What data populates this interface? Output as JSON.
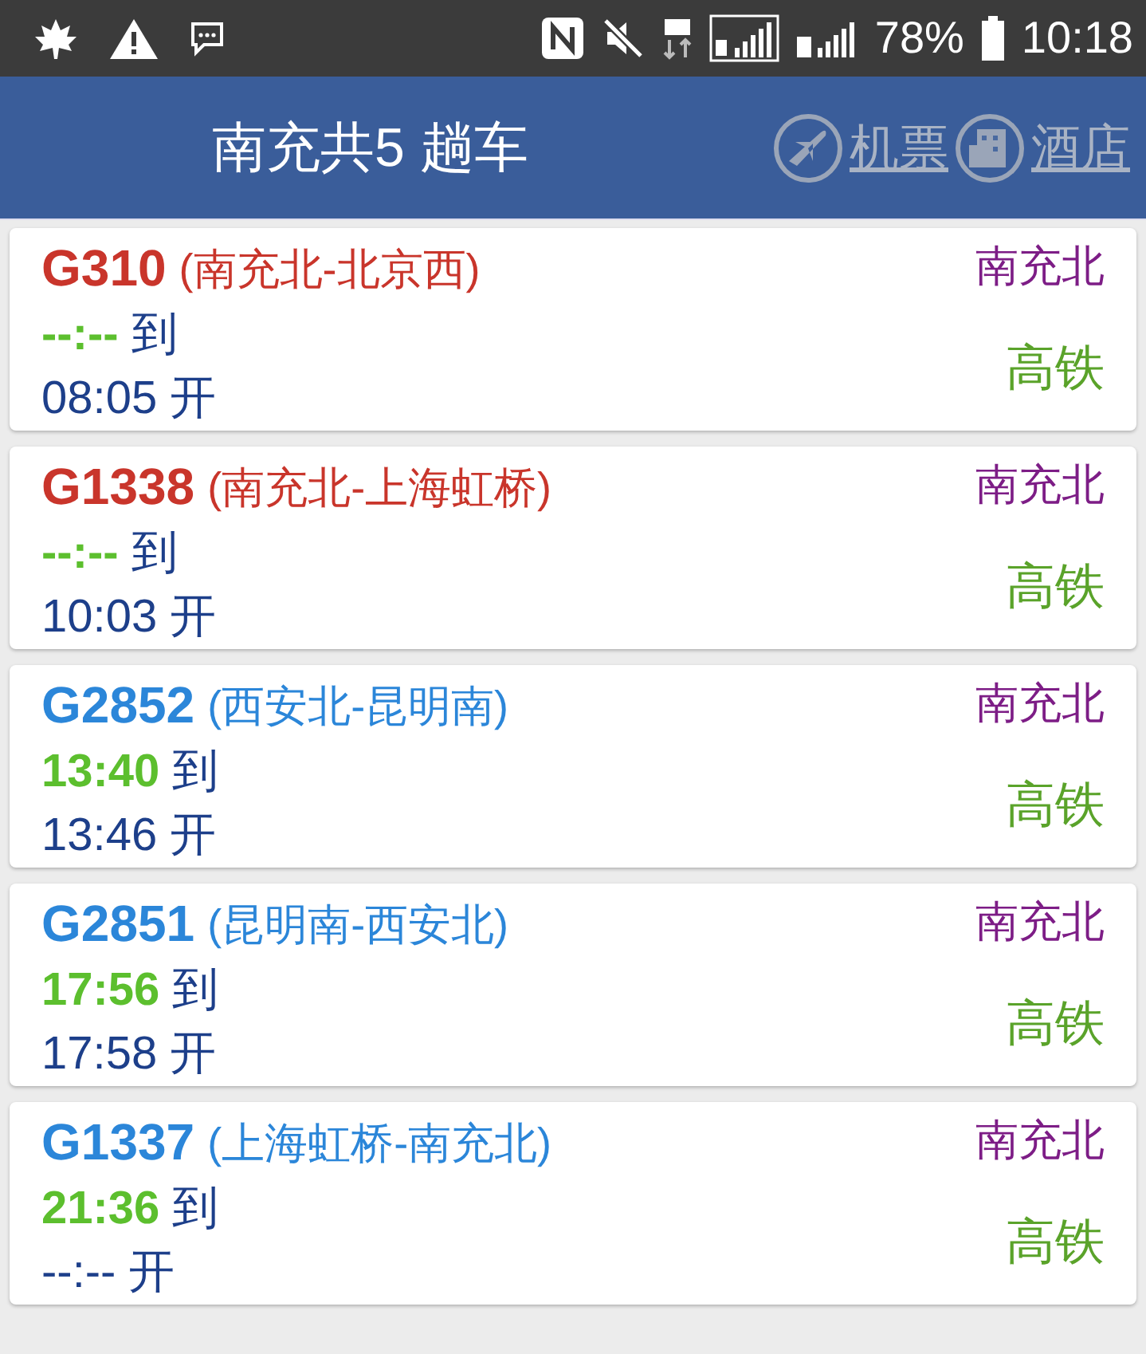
{
  "status_bar": {
    "battery": "78%",
    "time": "10:18"
  },
  "header": {
    "title": "南充共5 趟车",
    "links": [
      {
        "kind": "plane",
        "label": "机票"
      },
      {
        "kind": "hotel",
        "label": "酒店"
      }
    ]
  },
  "trains": [
    {
      "number": "G310",
      "route": "(南充北-北京西)",
      "color": "#c9352b",
      "arrive_time": "--:--",
      "arrive_label": "到",
      "depart_time": "08:05",
      "depart_label": "开",
      "station": "南充北",
      "train_type": "高铁"
    },
    {
      "number": "G1338",
      "route": "(南充北-上海虹桥)",
      "color": "#c9352b",
      "arrive_time": "--:--",
      "arrive_label": "到",
      "depart_time": "10:03",
      "depart_label": "开",
      "station": "南充北",
      "train_type": "高铁"
    },
    {
      "number": "G2852",
      "route": "(西安北-昆明南)",
      "color": "#2b86d9",
      "arrive_time": "13:40",
      "arrive_label": "到",
      "depart_time": "13:46",
      "depart_label": "开",
      "station": "南充北",
      "train_type": "高铁"
    },
    {
      "number": "G2851",
      "route": "(昆明南-西安北)",
      "color": "#2b86d9",
      "arrive_time": "17:56",
      "arrive_label": "到",
      "depart_time": "17:58",
      "depart_label": "开",
      "station": "南充北",
      "train_type": "高铁"
    },
    {
      "number": "G1337",
      "route": "(上海虹桥-南充北)",
      "color": "#2b86d9",
      "arrive_time": "21:36",
      "arrive_label": "到",
      "depart_time": "--:--",
      "depart_label": "开",
      "station": "南充北",
      "train_type": "高铁"
    }
  ]
}
